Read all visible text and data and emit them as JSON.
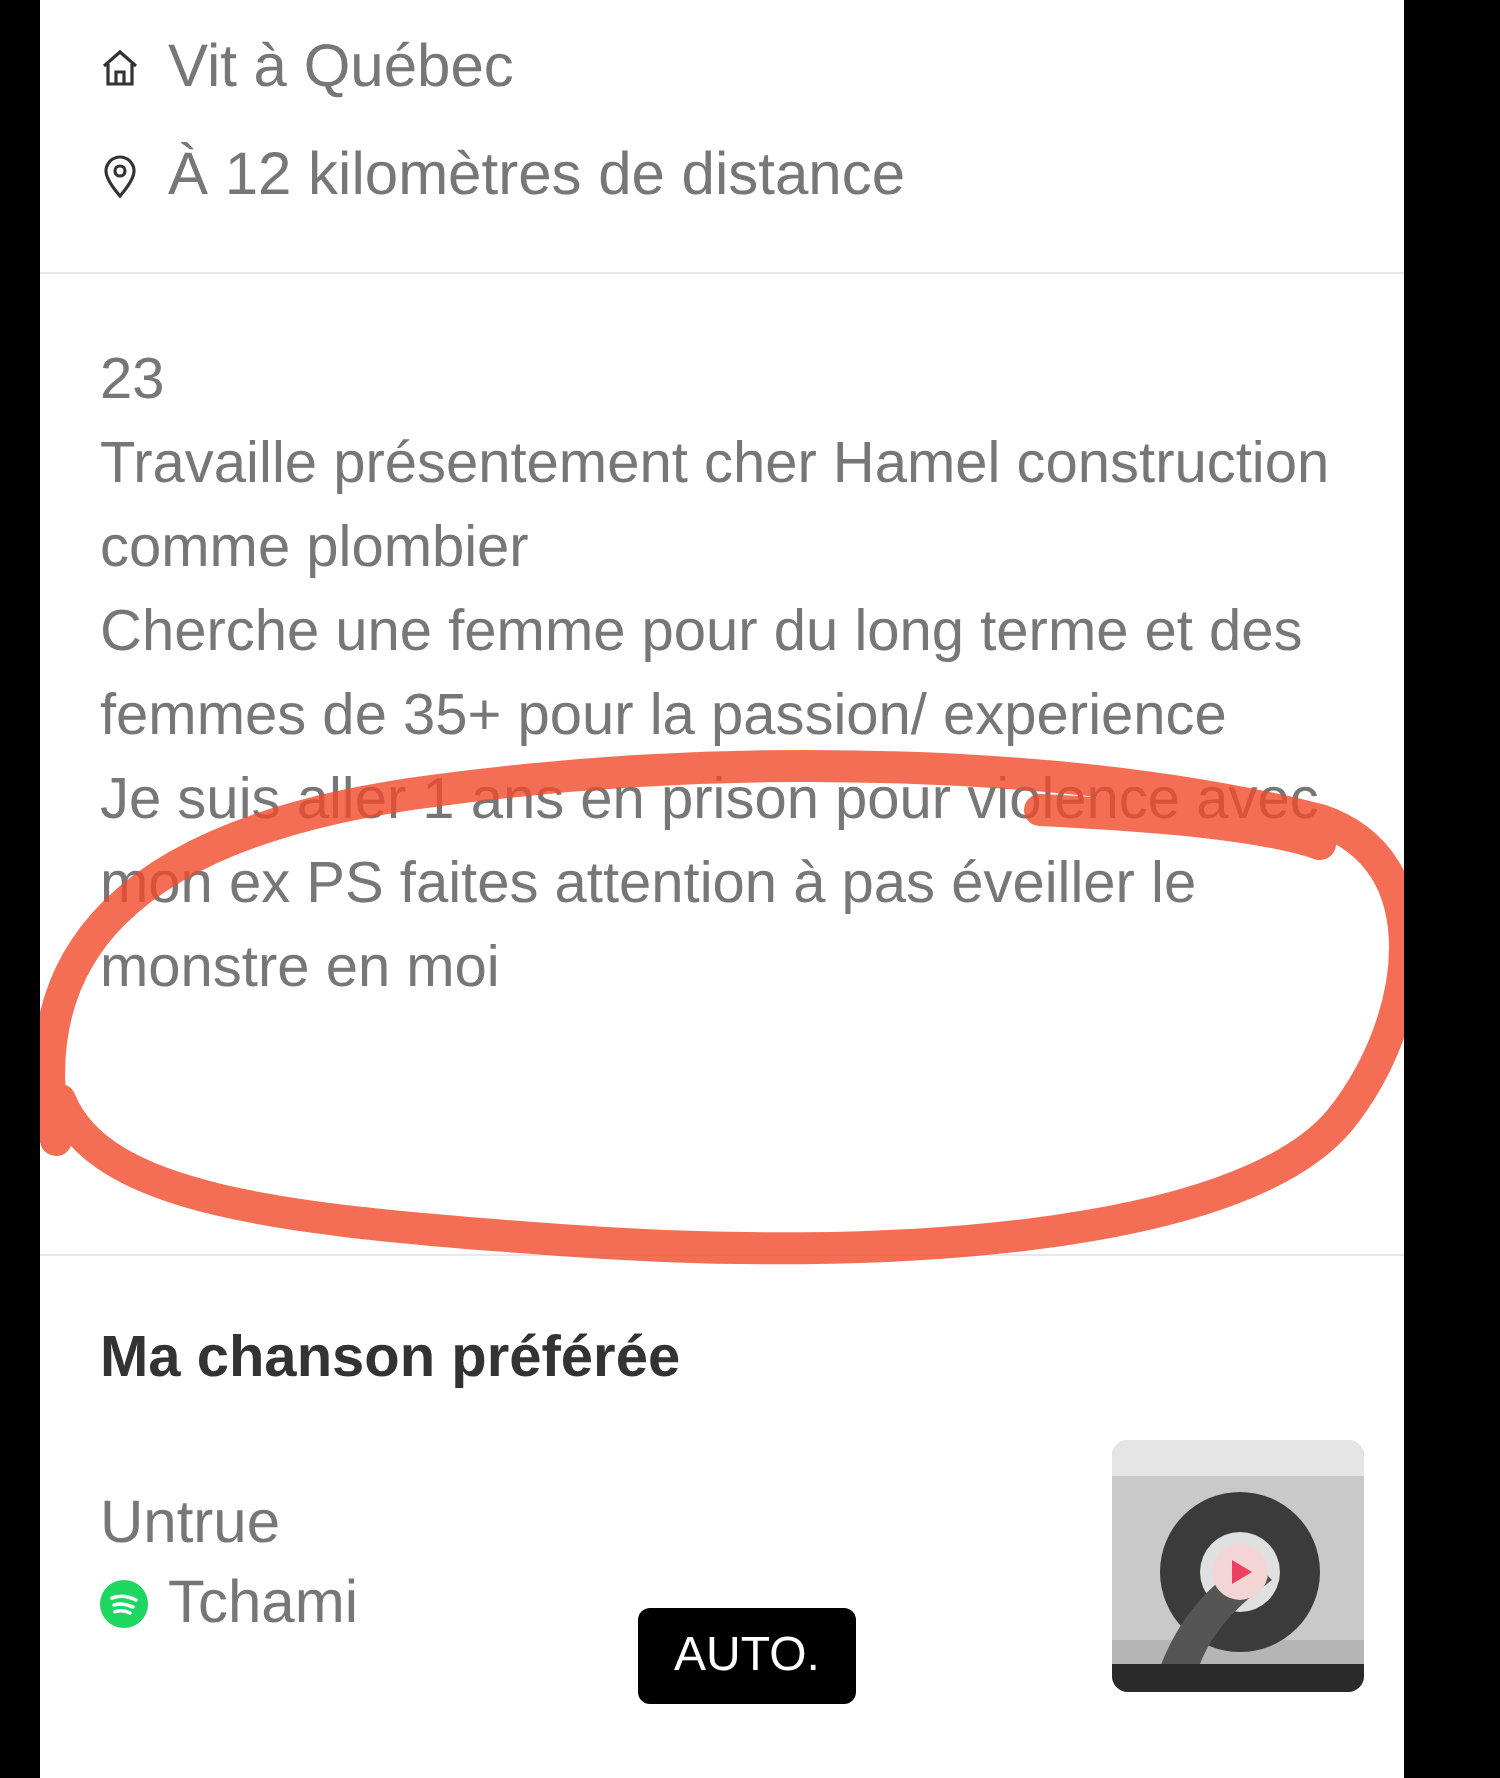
{
  "location": [
    {
      "kind": "home",
      "text": "Vit à Québec"
    },
    {
      "kind": "pin",
      "text": "À 12 kilomètres de distance"
    }
  ],
  "bio_lines": [
    "23",
    "Travaille présentement cher Hamel construction comme plombier",
    "Cherche une femme pour du long terme et des femmes de 35+ pour la passion/ experience",
    "Je suis aller 1 ans en prison pour violence avec mon ex PS faites attention à pas éveiller le monstre en moi"
  ],
  "favorite_song": {
    "heading": "Ma chanson préférée",
    "title": "Untrue",
    "artist": "Tchami"
  },
  "badge": "AUTO."
}
